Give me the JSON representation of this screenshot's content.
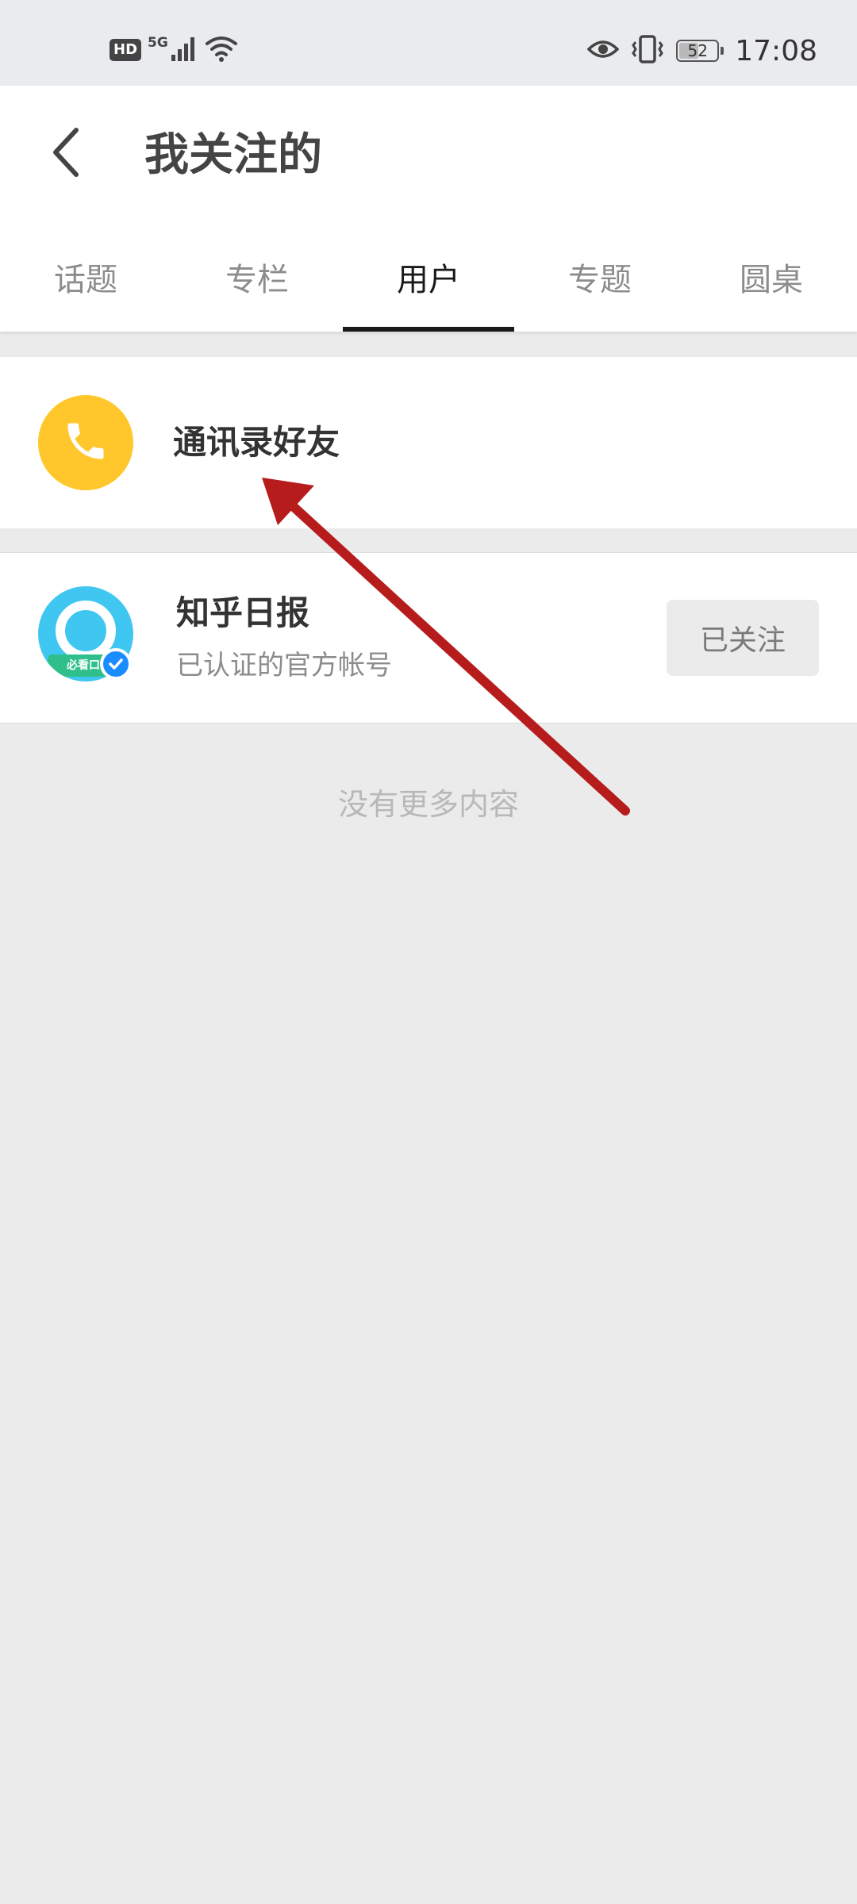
{
  "status_bar": {
    "hd": "HD",
    "network": "5G",
    "battery": "52",
    "battery_level": 0.52,
    "time": "17:08"
  },
  "header": {
    "title": "我关注的",
    "back_icon": "chevron-left-icon"
  },
  "tabs": [
    {
      "label": "话题",
      "active": false
    },
    {
      "label": "专栏",
      "active": false
    },
    {
      "label": "用户",
      "active": true
    },
    {
      "label": "专题",
      "active": false
    },
    {
      "label": "圆桌",
      "active": false
    }
  ],
  "contacts_entry": {
    "icon": "phone-icon",
    "label": "通讯录好友",
    "color": "#ffc72c"
  },
  "users": [
    {
      "name": "知乎日报",
      "description": "已认证的官方帐号",
      "avatar_banner": "必看口",
      "verified": true,
      "follow_label": "已关注"
    }
  ],
  "footer": {
    "no_more_text": "没有更多内容"
  },
  "colors": {
    "page_background": "#ebebeb",
    "status_bar_background": "#e9ebee",
    "accent_phone": "#ffc72c",
    "avatar_blue": "#3fc7f2",
    "verified_blue": "#1a8cff",
    "annotation_arrow": "#b71c1c"
  }
}
